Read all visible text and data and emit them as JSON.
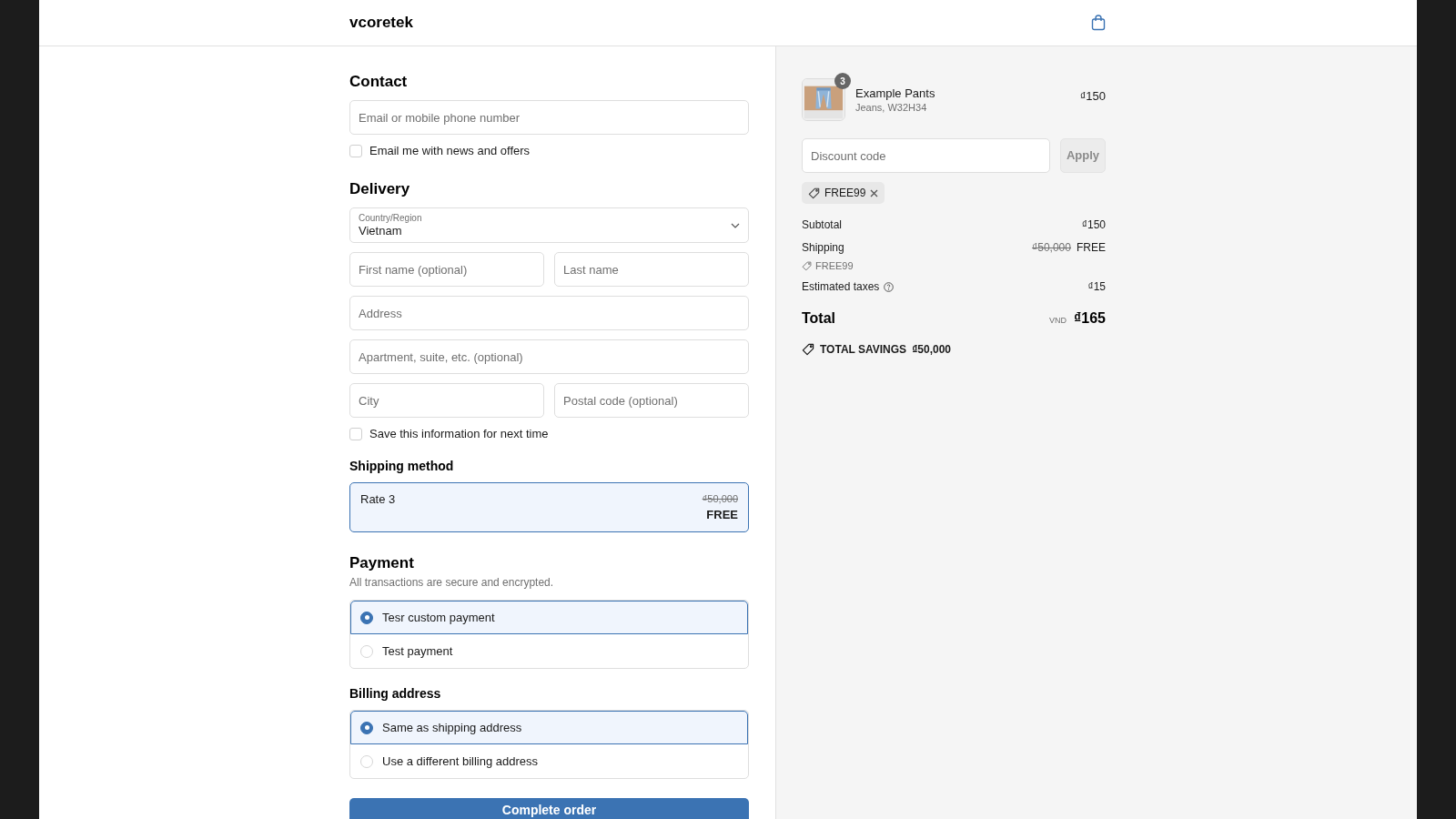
{
  "header": {
    "logo": "vcoretek"
  },
  "contact": {
    "heading": "Contact",
    "email_field": {
      "placeholder": "Email or mobile phone number"
    },
    "newsletter": {
      "label": "Email me with news and offers",
      "checked": false
    }
  },
  "delivery": {
    "heading": "Delivery",
    "country": {
      "label": "Country/Region",
      "value": "Vietnam"
    },
    "rows": [
      {
        "fields": [
          {
            "placeholder": "First name (optional)"
          },
          {
            "placeholder": "Last name"
          }
        ]
      },
      {
        "fields": [
          {
            "placeholder": "Address"
          }
        ]
      },
      {
        "fields": [
          {
            "placeholder": "Apartment, suite, etc. (optional)"
          }
        ]
      },
      {
        "fields": [
          {
            "placeholder": "City"
          },
          {
            "placeholder": "Postal code (optional)"
          }
        ]
      }
    ],
    "save_info": {
      "label": "Save this information for next time",
      "checked": false
    }
  },
  "shipping_method": {
    "heading": "Shipping method",
    "rates": [
      {
        "name": "Rate 3",
        "original_price": "₫50,000",
        "price": "FREE",
        "selected": true
      }
    ]
  },
  "payment": {
    "heading": "Payment",
    "subtitle": "All transactions are secure and encrypted.",
    "options": [
      {
        "label": "Tesr custom payment",
        "selected": true
      },
      {
        "label": "Test payment",
        "selected": false
      }
    ]
  },
  "billing": {
    "heading": "Billing address",
    "options": [
      {
        "label": "Same as shipping address",
        "selected": true
      },
      {
        "label": "Use a different billing address",
        "selected": false
      }
    ]
  },
  "complete_button": "Complete order",
  "summary": {
    "items": [
      {
        "name": "Example Pants",
        "variant": "Jeans, W32H34",
        "price": "₫150",
        "quantity": "3"
      }
    ],
    "discount_field": {
      "placeholder": "Discount code"
    },
    "apply_button": {
      "label": "Apply",
      "disabled": true
    },
    "applied_codes": [
      {
        "code": "FREE99"
      }
    ],
    "lines": [
      {
        "label": "Subtotal",
        "value": "₫150"
      },
      {
        "label": "Shipping",
        "original": "₫50,000",
        "value": "FREE",
        "code": "FREE99"
      },
      {
        "label": "Estimated taxes",
        "info": true,
        "value": "₫15"
      }
    ],
    "total": {
      "label": "Total",
      "currency": "VND",
      "value": "₫165"
    },
    "savings": {
      "label": "TOTAL SAVINGS",
      "value": "₫50,000"
    }
  }
}
